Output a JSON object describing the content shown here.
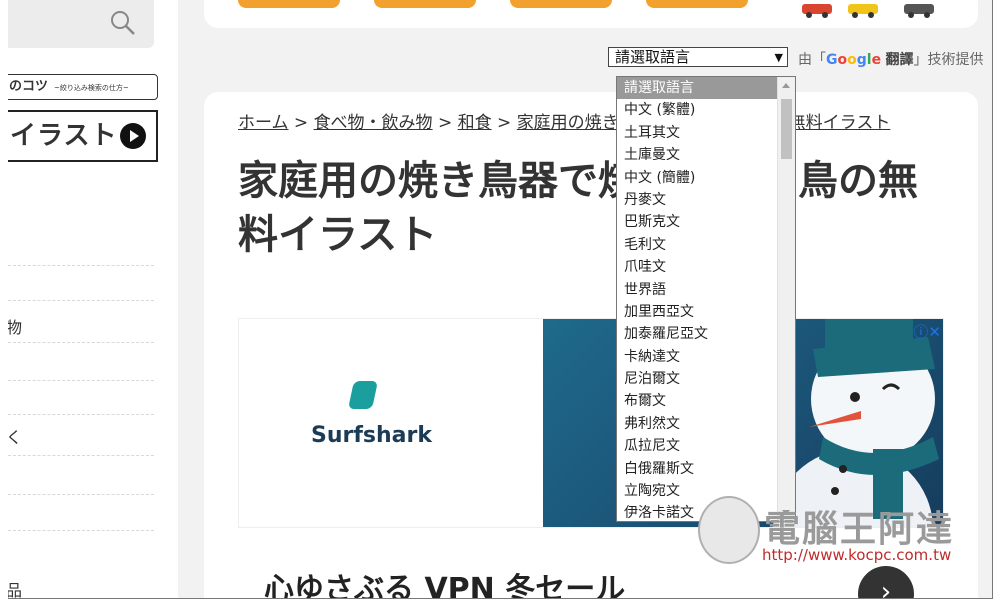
{
  "sidebar": {
    "search_icon": "search-icon",
    "koutsu_label": "のコツ",
    "koutsu_sub": "~絞り込み検索の仕方~",
    "illust_label": "イラスト",
    "frag_1": "物",
    "frag_2": "く",
    "frag_3": "品"
  },
  "translate": {
    "select_value": "請選取語言",
    "powered_prefix": "由「",
    "google": "Google",
    "translate_word": "翻譯",
    "powered_suffix": "」技術提供",
    "options": [
      "請選取語言",
      "中文 (繁體)",
      "土耳其文",
      "土庫曼文",
      "中文 (簡體)",
      "丹麥文",
      "巴斯克文",
      "毛利文",
      "爪哇文",
      "世界語",
      "加里西亞文",
      "加泰羅尼亞文",
      "卡納達文",
      "尼泊爾文",
      "布爾文",
      "弗利然文",
      "瓜拉尼文",
      "白俄羅斯文",
      "立陶宛文",
      "伊洛卡諾文"
    ]
  },
  "main": {
    "breadcrumb": [
      "ホーム",
      " > ",
      "食べ物・飲み物",
      " > ",
      "和食",
      " > ",
      "家庭用の焼き鳥器で焼いた焼き鳥の無料イラスト"
    ],
    "title": "家庭用の焼き鳥器で焼いた焼き鳥の無料イラスト",
    "ad_brand": "Surfshark",
    "ad_headline": "心ゆさぶる VPN 冬セール"
  },
  "watermark": {
    "title": "電腦王阿達",
    "url": "http://www.kocpc.com.tw"
  },
  "colors": {
    "accent_orange": "#f3a12e",
    "selected_option": "#999999"
  }
}
